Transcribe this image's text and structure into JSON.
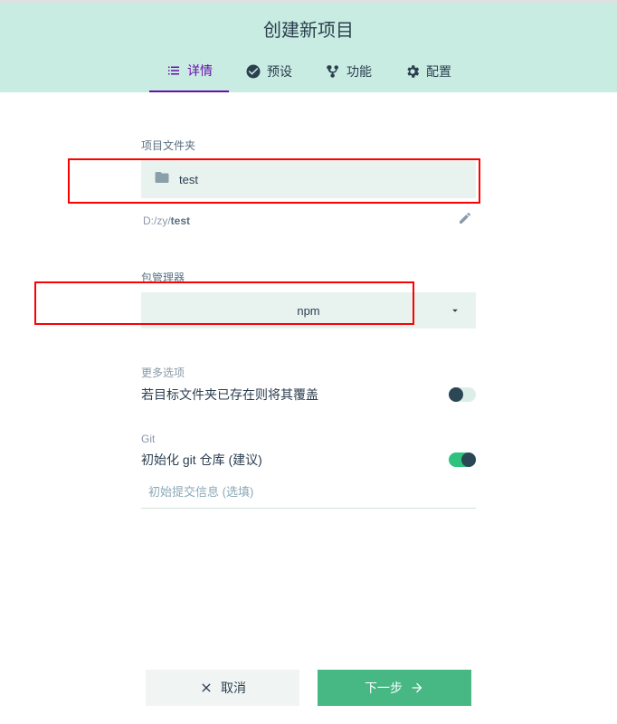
{
  "header": {
    "title": "创建新项目"
  },
  "tabs": {
    "items": [
      {
        "label": "详情",
        "icon": "list-icon",
        "active": true
      },
      {
        "label": "预设",
        "icon": "check-circle-icon",
        "active": false
      },
      {
        "label": "功能",
        "icon": "fork-icon",
        "active": false
      },
      {
        "label": "配置",
        "icon": "settings-icon",
        "active": false
      }
    ]
  },
  "folder": {
    "label": "项目文件夹",
    "name": "test",
    "path_prefix": "D:/zy/",
    "path_name": "test"
  },
  "package_manager": {
    "label": "包管理器",
    "selected": "npm"
  },
  "more_options": {
    "label": "更多选项",
    "overwrite_text": "若目标文件夹已存在则将其覆盖",
    "overwrite_enabled": false
  },
  "git": {
    "label": "Git",
    "init_text": "初始化 git 仓库 (建议)",
    "init_enabled": true,
    "commit_placeholder": "初始提交信息 (选填)"
  },
  "footer": {
    "cancel_label": "取消",
    "next_label": "下一步"
  }
}
